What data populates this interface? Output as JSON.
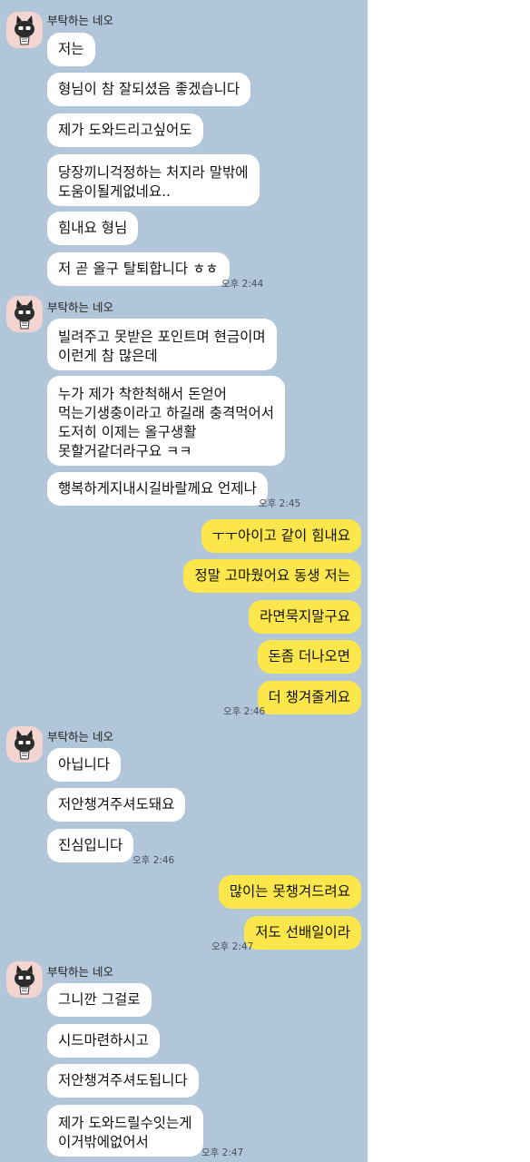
{
  "groups": [
    {
      "sender": "부탁하는 네오",
      "messages": [
        "저는",
        "형님이 참 잘되셨음 좋겠습니다",
        "제가 도와드리고싶어도",
        "당장끼니걱정하는 처지라 말밖에\n도움이될게없네요..",
        "힘내요 형님",
        "저 곧 올구 탈퇴합니다 ㅎㅎ"
      ],
      "time": "오후 2:44"
    },
    {
      "sender": "부탁하는 네오",
      "messages": [
        "빌려주고 못받은 포인트며 현금이며\n이런게 참 많은데",
        "누가 제가 착한척해서 돈얻어\n먹는기생충이라고 하길래 충격먹어서\n도저히 이제는 올구생활\n못할거같더라구요 ㅋㅋ",
        "행복하게지내시길바랄께요 언제나"
      ],
      "time": "오후 2:45"
    },
    {
      "outgoing": true,
      "messages": [
        "ㅜㅜ아이고 같이 힘내요",
        "정말 고마웠어요 동생 저는",
        "라면묵지말구요",
        "돈좀 더나오면",
        "더 챙겨줄게요"
      ],
      "time": "오후 2:46"
    },
    {
      "sender": "부탁하는 네오",
      "messages": [
        "아닙니다",
        "저안챙겨주셔도돼요",
        "진심입니다"
      ],
      "time": "오후 2:46"
    },
    {
      "outgoing": true,
      "messages": [
        "많이는 못챙겨드려요",
        "저도 선배일이라"
      ],
      "time": "오후 2:47"
    },
    {
      "sender": "부탁하는 네오",
      "messages": [
        "그니깐 그걸로",
        "시드마련하시고",
        "저안챙겨주셔도됩니다",
        "제가 도와드릴수잇는게\n이거밖에없어서"
      ],
      "time": "오후 2:47"
    }
  ],
  "colors": {
    "chat_background": "#b2c6d9",
    "incoming_bubble": "#ffffff",
    "outgoing_bubble": "#fbe64c",
    "avatar_background": "#f2d4d1"
  },
  "icons": {
    "avatar": "neo-character-avatar-icon"
  }
}
